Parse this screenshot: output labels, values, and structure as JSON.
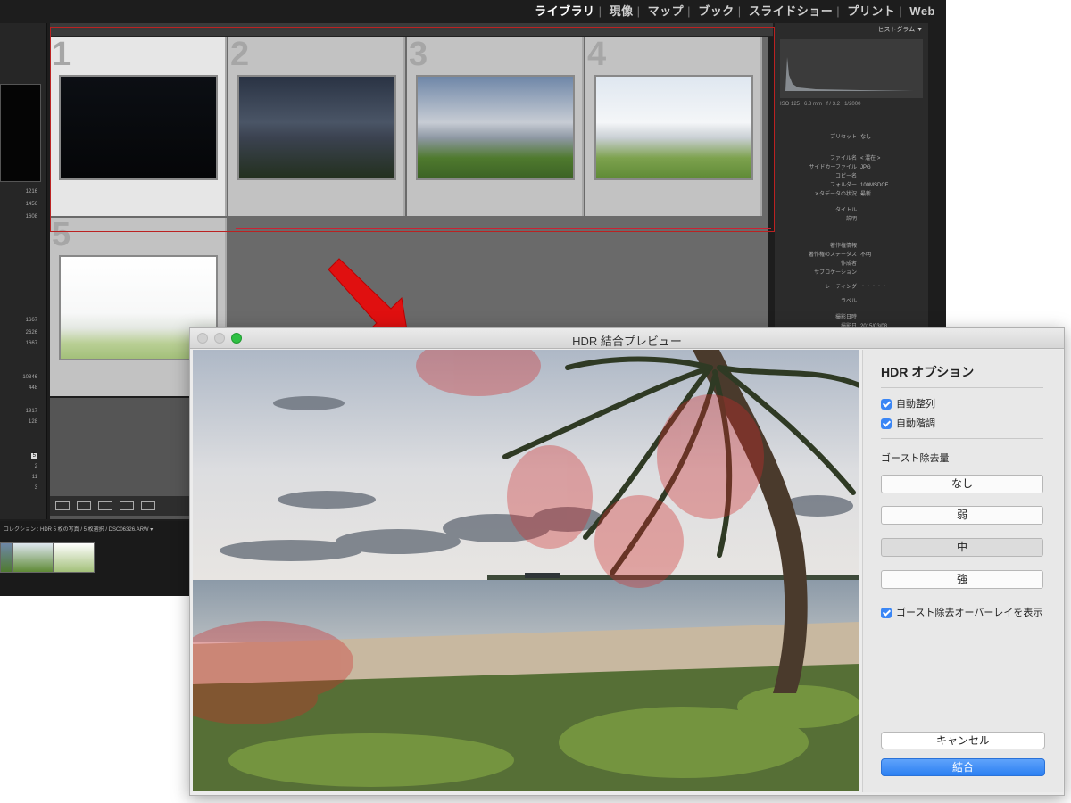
{
  "lightroom": {
    "modules": [
      "ライブラリ",
      "現像",
      "マップ",
      "ブック",
      "スライドショー",
      "プリント",
      "Web"
    ],
    "active_module": "ライブラリ",
    "grid_numbers": [
      "1",
      "2",
      "3",
      "4",
      "5"
    ],
    "left_counts": [
      "1216",
      "1456",
      "1608",
      "1667",
      "2626",
      "1667",
      "10846",
      "448",
      "1917",
      "128",
      "5",
      "2",
      "11",
      "3"
    ],
    "histogram_title": "ヒストグラム ▼",
    "histogram_info": [
      "ISO 125",
      "6.8 mm",
      "f / 3.2",
      "1/2000"
    ],
    "metadata": [
      {
        "key": "プリセット",
        "value": "なし"
      },
      {
        "key": "ファイル名",
        "value": "< 混在 >"
      },
      {
        "key": "サイドカーファイル",
        "value": "JPG"
      },
      {
        "key": "コピー名",
        "value": ""
      },
      {
        "key": "フォルダー",
        "value": "100MSDCF"
      },
      {
        "key": "メタデータの状況",
        "value": "最新"
      },
      {
        "key": "タイトル",
        "value": ""
      },
      {
        "key": "説明",
        "value": ""
      },
      {
        "key": "著作権情報",
        "value": ""
      },
      {
        "key": "著作権のステータス",
        "value": "不明"
      },
      {
        "key": "作成者",
        "value": ""
      },
      {
        "key": "サブロケーション",
        "value": ""
      },
      {
        "key": "レーティング",
        "value": "・・・・・"
      },
      {
        "key": "ラベル",
        "value": ""
      },
      {
        "key": "撮影日時",
        "value": ""
      },
      {
        "key": "撮影日",
        "value": "2015/03/08"
      }
    ],
    "filmstrip_label": "コレクション : HDR 5 枚の写真 / 5 枚選択 / DSC06326.ARW ▾"
  },
  "dialog": {
    "title": "HDR 結合プレビュー",
    "options_title": "HDR オプション",
    "auto_align": "自動整列",
    "auto_tone": "自動階調",
    "ghost_label": "ゴースト除去量",
    "ghost_options": [
      "なし",
      "弱",
      "中",
      "強"
    ],
    "ghost_selected": "中",
    "show_overlay": "ゴースト除去オーバーレイを表示",
    "cancel": "キャンセル",
    "merge": "結合"
  },
  "colors": {
    "accent_blue": "#2c80f2",
    "ghost_overlay": "#d22a2a",
    "annotation_arrow": "#e01010"
  }
}
